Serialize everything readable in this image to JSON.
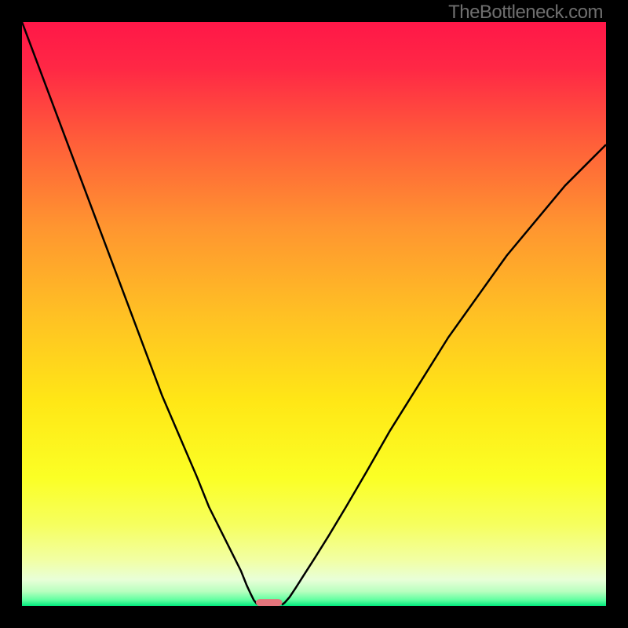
{
  "watermark": "TheBottleneck.com",
  "chart_data": {
    "type": "line",
    "title": "",
    "xlabel": "",
    "ylabel": "",
    "xlim": [
      0,
      100
    ],
    "ylim": [
      0,
      100
    ],
    "background_gradient": {
      "stops": [
        {
          "offset": 0.0,
          "color": "#ff1748"
        },
        {
          "offset": 0.08,
          "color": "#ff2845"
        },
        {
          "offset": 0.2,
          "color": "#ff5c3a"
        },
        {
          "offset": 0.35,
          "color": "#ff9530"
        },
        {
          "offset": 0.5,
          "color": "#ffc024"
        },
        {
          "offset": 0.65,
          "color": "#ffe716"
        },
        {
          "offset": 0.78,
          "color": "#fbff25"
        },
        {
          "offset": 0.86,
          "color": "#f6ff5e"
        },
        {
          "offset": 0.92,
          "color": "#f2ffa2"
        },
        {
          "offset": 0.955,
          "color": "#e8ffd8"
        },
        {
          "offset": 0.975,
          "color": "#b8ffbf"
        },
        {
          "offset": 0.99,
          "color": "#5effa0"
        },
        {
          "offset": 1.0,
          "color": "#00e97d"
        }
      ]
    },
    "series": [
      {
        "name": "left-curve",
        "x": [
          0,
          3,
          6,
          9,
          12,
          15,
          18,
          21,
          24,
          27,
          30,
          32,
          34,
          36,
          37.5,
          38.5,
          39.2,
          39.7,
          40.2,
          40.5
        ],
        "y": [
          100,
          92,
          84,
          76,
          68,
          60,
          52,
          44,
          36,
          29,
          22,
          17,
          13,
          9,
          6,
          3.5,
          2,
          1,
          0.4,
          0.2
        ]
      },
      {
        "name": "right-curve",
        "x": [
          44.5,
          45,
          45.8,
          46.8,
          48.2,
          50,
          52.5,
          55.5,
          59,
          63,
          68,
          73,
          78,
          83,
          88,
          93,
          97,
          100
        ],
        "y": [
          0.2,
          0.6,
          1.5,
          3,
          5.2,
          8,
          12,
          17,
          23,
          30,
          38,
          46,
          53,
          60,
          66,
          72,
          76,
          79
        ]
      }
    ],
    "marker": {
      "shape": "rounded-rect",
      "x_center": 42.3,
      "y": 0,
      "width": 4.5,
      "height": 1.2,
      "color": "#e4747c"
    }
  }
}
